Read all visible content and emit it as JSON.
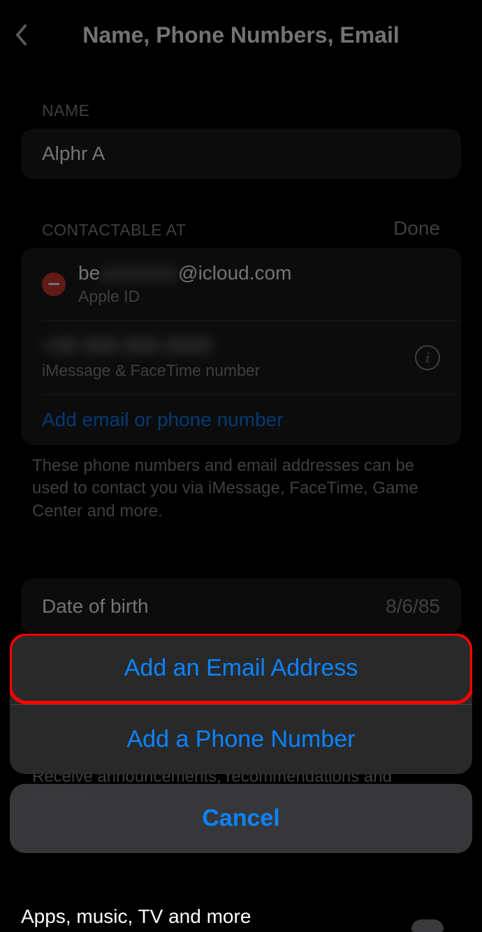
{
  "header": {
    "title": "Name, Phone Numbers, Email"
  },
  "name_section": {
    "label": "NAME",
    "value": "Alphr A"
  },
  "contact_section": {
    "label": "CONTACTABLE AT",
    "done_label": "Done",
    "items": [
      {
        "prefix": "be",
        "blurred": "xxxxxxxx",
        "suffix": "@icloud.com",
        "subtitle": "Apple ID",
        "deletable": true
      },
      {
        "blurred_full": "+00 000 000 0000",
        "subtitle": "iMessage & FaceTime number",
        "info": true
      }
    ],
    "add_label": "Add email or phone number",
    "footer": "These phone numbers and email addresses can be used to contact you via iMessage, FaceTime, Game Center and more."
  },
  "dob": {
    "label": "Date of birth",
    "value": "8/6/85"
  },
  "announcements_footer": "Receive announcements, recommendations and updates",
  "apps_row_label": "Apps, music, TV and more",
  "action_sheet": {
    "add_email": "Add an Email Address",
    "add_phone": "Add a Phone Number",
    "cancel": "Cancel"
  }
}
